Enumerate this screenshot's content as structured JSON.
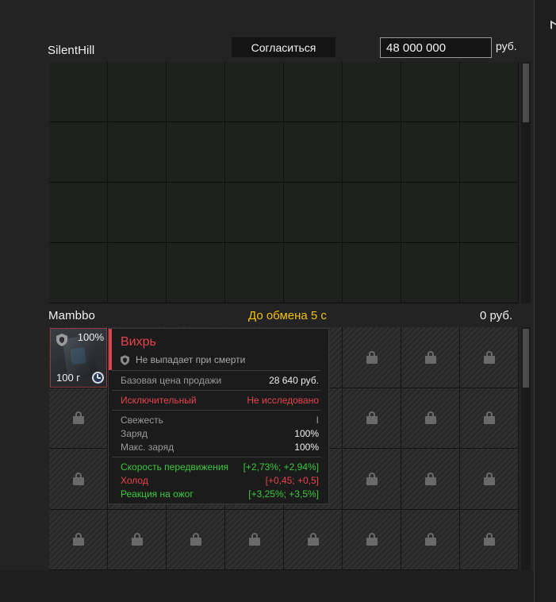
{
  "trade": {
    "partner_name": "SilentHill",
    "accept_label": "Согласиться",
    "offer_amount": "48 000 000",
    "currency": "руб.",
    "own_name": "Mambbo",
    "timer_text": "До обмена 5 с",
    "own_money": "0 руб."
  },
  "item": {
    "durability": "100%",
    "weight": "100 г",
    "icons": [
      "shield-icon",
      "clock-icon"
    ]
  },
  "tooltip": {
    "name": "Вихрь",
    "drop_note": "Не выпадает при смерти",
    "base_price_label": "Базовая цена продажи",
    "base_price_value": "28 640 руб.",
    "rarity_label": "Исключительный",
    "research_status": "Не исследовано",
    "freshness_label": "Свежесть",
    "freshness_value": "I",
    "charge_label": "Заряд",
    "charge_value": "100%",
    "max_charge_label": "Макс. заряд",
    "max_charge_value": "100%",
    "stats": [
      {
        "label": "Скорость передвижения",
        "value": "[+2,73%; +2,94%]",
        "color": "#3dc93d"
      },
      {
        "label": "Холод",
        "value": "[+0,45; +0,5]",
        "color": "#e8434f"
      },
      {
        "label": "Реакция на ожог",
        "value": "[+3,25%; +3,5%]",
        "color": "#3dc93d"
      }
    ]
  },
  "colors": {
    "accent_red": "#e8434f",
    "timer_yellow": "#f2c200",
    "positive_green": "#3dc93d"
  }
}
